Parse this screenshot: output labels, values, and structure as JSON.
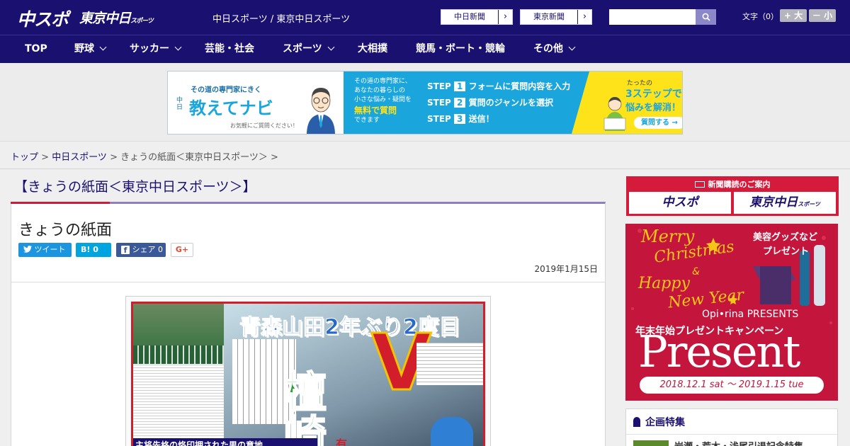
{
  "header": {
    "logo_chuspo": "中スポ",
    "logo_tokyo_main": "東京中日",
    "logo_tokyo_sub": "スポーツ",
    "site_title": "中日スポーツ / 東京中日スポーツ",
    "link_chunichi": "中日新聞",
    "link_tokyo": "東京新聞",
    "search_placeholder": "",
    "font_size_label": "文字（0）",
    "font_bigger": "+ 大",
    "font_smaller": "－ 小"
  },
  "nav": [
    {
      "label": "TOP"
    },
    {
      "label": "野球"
    },
    {
      "label": "サッカー"
    },
    {
      "label": "芸能・社会"
    },
    {
      "label": "スポーツ"
    },
    {
      "label": "大相撲"
    },
    {
      "label": "競馬・ボート・競輪"
    },
    {
      "label": "その他"
    }
  ],
  "ad": {
    "pre": "その道の専門家にきく",
    "brand_small": "中日",
    "brand": "教えてナビ",
    "note": "お気軽にご質問ください！",
    "desc1": "その道の専門家に、",
    "desc2": "あなたの暮らしの",
    "desc3": "小さな悩み・疑問を",
    "free": "無料で質問",
    "desc4": "できます",
    "step_word": "STEP",
    "step1_num": "1",
    "step1": "フォームに質問内容を入力",
    "step2_num": "2",
    "step2": "質問のジャンルを選択",
    "step3_num": "3",
    "step3": "送信！",
    "promo1": "たったの",
    "promo2": "3ステップで",
    "promo3": "悩みを解消！",
    "cta": "質問する →"
  },
  "breadcrumb": {
    "top": "トップ",
    "sep1": " > ",
    "chunichi": "中日スポーツ",
    "sep2": " > ",
    "current": "きょうの紙面＜東京中日スポーツ＞",
    "sep3": " >"
  },
  "page_heading": "【きょうの紙面＜東京中日スポーツ＞】",
  "article": {
    "title": "きょうの紙面",
    "tweet": "ツイート",
    "hatena_label": "B!",
    "hatena_count": "0",
    "fb_label": "シェア",
    "fb_count": "0",
    "gplus": "G+",
    "date": "2019年1月15日"
  },
  "paper": {
    "headline": "青森山田2年ぶり2度目",
    "big_letter": "V",
    "name1": "檀",
    "name2": "崎",
    "sub_char": "有",
    "bottom_caption": "主将先格の烙印押された男の意地"
  },
  "sidebar": {
    "subscribe_title": "新聞購読のご案内",
    "btn_chuspo": "中スポ",
    "btn_tokyo_main": "東京中日",
    "btn_tokyo_sub": "スポーツ",
    "xmas_merry": "Merry",
    "xmas_christmas": "Christmas",
    "xmas_and": "&",
    "xmas_happy": "Happy",
    "xmas_newyear": "New Year",
    "xmas_beauty": "美容グッズなど",
    "xmas_gift": "プレゼント",
    "xmas_brand": "Opi•rina PRESENTS",
    "xmas_campaign": "年末年始プレゼントキャンペーン",
    "xmas_present": "Present",
    "xmas_period": "2018.12.1 sat ～ 2019.1.15 tue",
    "feature_title": "企画特集",
    "feature_item": "岩瀬・荒木・浅尾引退記念特集"
  },
  "colors": {
    "navy": "#1a1070",
    "accent_red": "#d41b3b",
    "twitter": "#1b95e0",
    "hatena": "#00a4de",
    "facebook": "#3b5998"
  }
}
